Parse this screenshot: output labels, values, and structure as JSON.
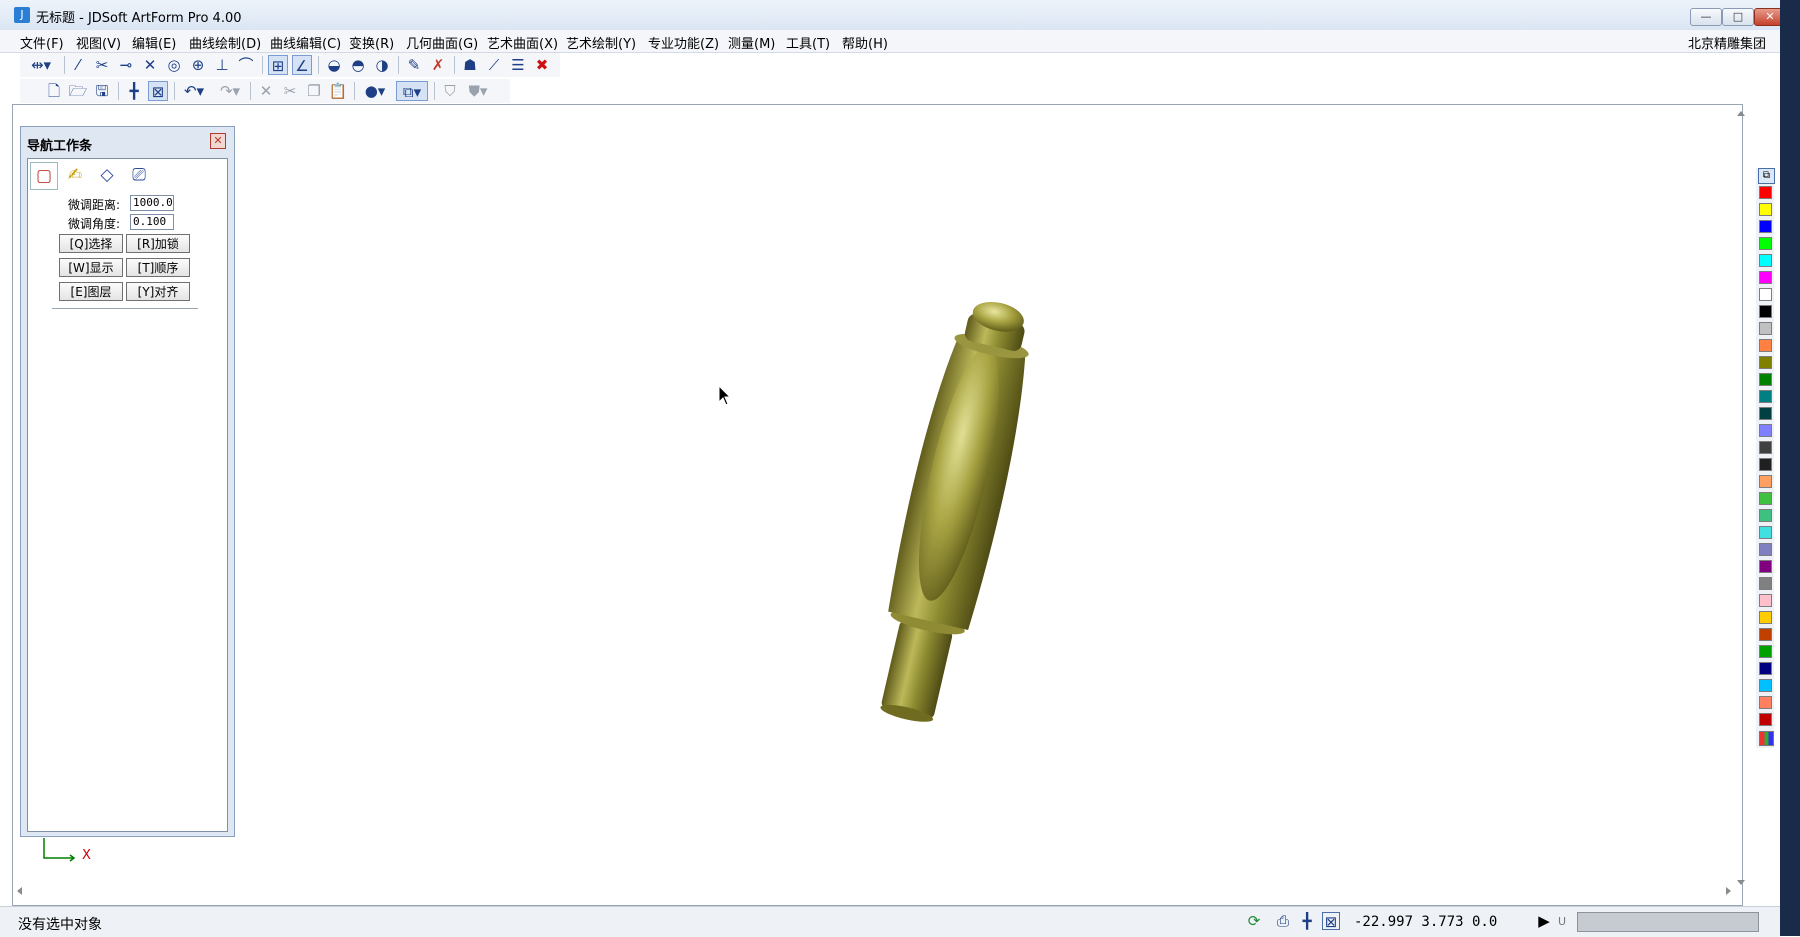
{
  "window": {
    "title": "无标题 - JDSoft ArtForm Pro 4.00",
    "minimize_glyph": "—",
    "maximize_glyph": "□",
    "close_glyph": "✕"
  },
  "menu": {
    "items": [
      "文件(F)",
      "视图(V)",
      "编辑(E)",
      "曲线绘制(D)",
      "曲线编辑(C)",
      "变换(R)",
      "几何曲面(G)",
      "艺术曲面(X)",
      "艺术绘制(Y)",
      "专业功能(Z)",
      "测量(M)",
      "工具(T)",
      "帮助(H)"
    ],
    "company": "北京精雕集团"
  },
  "nav_panel": {
    "title": "导航工作条",
    "close_glyph": "✕",
    "fine_distance_label": "微调距离:",
    "fine_distance_value": "1000.0",
    "fine_angle_label": "微调角度:",
    "fine_angle_value": "0.100",
    "buttons": [
      "[Q]选择",
      "[R]加锁",
      "[W]显示",
      "[T]顺序",
      "[E]图层",
      "[Y]对齐"
    ]
  },
  "axis": {
    "x_label": "X"
  },
  "status": {
    "message": "没有选中对象",
    "coordinates": "-22.997  3.773  0.0",
    "unit_glyph": "U"
  },
  "palette_colors": [
    "#ff0000",
    "#ffff00",
    "#0000ff",
    "#00ff00",
    "#00ffff",
    "#ff00ff",
    "#ffffff",
    "#000000",
    "#c0c0c0",
    "#ff8040",
    "#808000",
    "#008000",
    "#008080",
    "#004040",
    "#8080ff",
    "#404040",
    "#202020",
    "#ffa060",
    "#40c040",
    "#40c080",
    "#40e0e0",
    "#8080c0",
    "#800080",
    "#808080",
    "#ffc0cb",
    "#ffcc00",
    "#c04000",
    "#00a000",
    "#000080",
    "#00c0ff",
    "#ff8060",
    "#c00000"
  ],
  "icons": {
    "toolbar1": [
      "snap-icon",
      "line-icon",
      "trim-icon",
      "extend-icon",
      "cross-icon",
      "circle-icon",
      "center-icon",
      "perpendicular-icon",
      "tangent-icon",
      "grid-icon",
      "angle-icon",
      "surface1-icon",
      "surface2-icon",
      "surface3-icon",
      "node-edit-icon",
      "node-delete-icon",
      "sculpt-icon",
      "measure-icon",
      "list-icon",
      "delete-icon"
    ],
    "toolbar2": [
      "new-file-icon",
      "open-folder-icon",
      "save-icon",
      "crosshair-icon",
      "zoom-box-icon",
      "undo-icon",
      "redo-icon",
      "cut-icon",
      "scissors-icon",
      "copy-icon",
      "paste-icon",
      "sphere-icon",
      "view-cube-icon",
      "shade1-icon",
      "shade2-icon"
    ]
  }
}
